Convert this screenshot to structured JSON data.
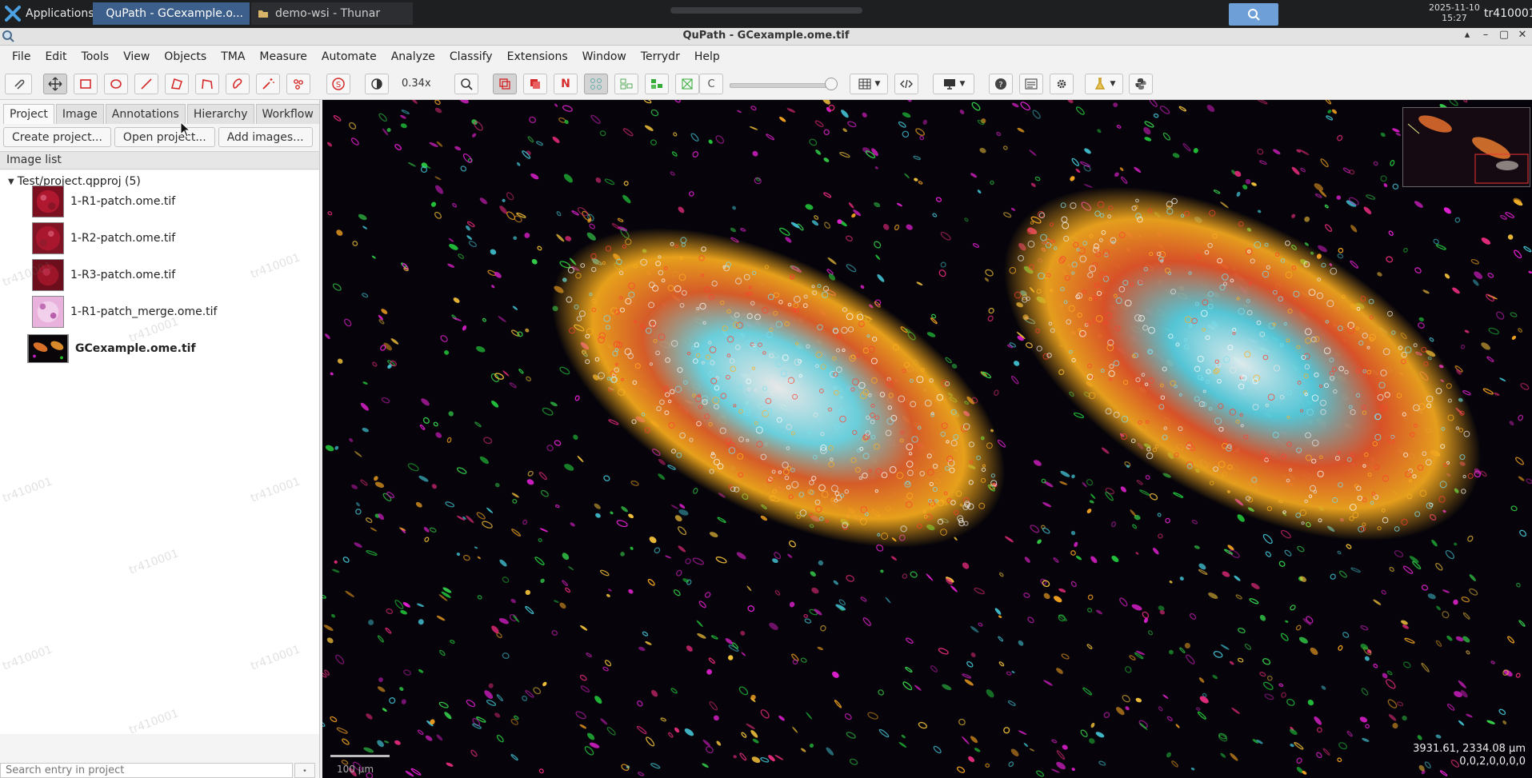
{
  "taskbar": {
    "applications_label": "Applications",
    "tasks": [
      {
        "label": "QuPath - GCexample.o...",
        "active": true
      },
      {
        "label": "demo-wsi - Thunar",
        "active": false
      }
    ],
    "clock": {
      "date": "2025-11-10",
      "time": "15:27"
    },
    "user": "tr410001"
  },
  "window": {
    "title": "QuPath - GCexample.ome.tif",
    "controls": [
      "▴",
      "–",
      "▢",
      "✕"
    ]
  },
  "menubar": [
    "File",
    "Edit",
    "Tools",
    "View",
    "Objects",
    "TMA",
    "Measure",
    "Automate",
    "Analyze",
    "Classify",
    "Extensions",
    "Window",
    "Terrydr",
    "Help"
  ],
  "toolbar": {
    "zoom": "0.34x",
    "c_label": "C",
    "n_label": "N",
    "accent_red": "#d52a2a"
  },
  "left": {
    "tabs": [
      "Project",
      "Image",
      "Annotations",
      "Hierarchy",
      "Workflow"
    ],
    "active_tab": "Project",
    "buttons": [
      "Create project...",
      "Open project...",
      "Add images..."
    ],
    "image_list_header": "Image list",
    "project_root": "Test/project.qpproj (5)",
    "images": [
      {
        "name": "1-R1-patch.ome.tif",
        "thumb": "red",
        "current": false
      },
      {
        "name": "1-R2-patch.ome.tif",
        "thumb": "red",
        "current": false
      },
      {
        "name": "1-R3-patch.ome.tif",
        "thumb": "red",
        "current": false
      },
      {
        "name": "1-R1-patch_merge.ome.tif",
        "thumb": "pink",
        "current": false
      },
      {
        "name": "GCexample.ome.tif",
        "thumb": "dark",
        "current": true
      }
    ],
    "search_placeholder": "Search entry in project"
  },
  "viewer": {
    "coord_line1": "3931.61, 2334.08 µm",
    "coord_line2": "0,0,2,0,0,0,0",
    "scale_label": "100 µm",
    "watermark": "tr410001"
  }
}
